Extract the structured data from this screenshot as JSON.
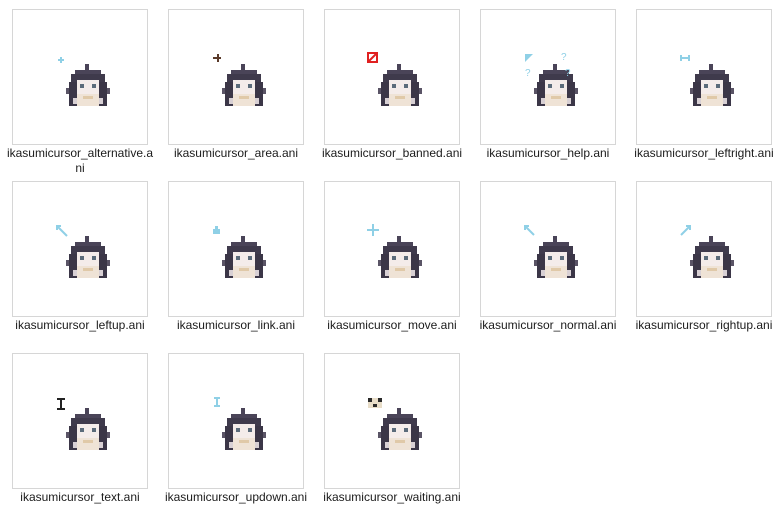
{
  "files": [
    {
      "name": "ikasumicursor_alternative.ani",
      "icon": "alternative-arrow-icon",
      "color": "#8fd0e6"
    },
    {
      "name": "ikasumicursor_area.ani",
      "icon": "crosshair-icon",
      "color": "#5a3a2a"
    },
    {
      "name": "ikasumicursor_banned.ani",
      "icon": "banned-icon",
      "color": "#e02020"
    },
    {
      "name": "ikasumicursor_help.ani",
      "icon": "help-icon",
      "color": "#8fd0e6"
    },
    {
      "name": "ikasumicursor_leftright.ani",
      "icon": "leftright-arrow-icon",
      "color": "#8fd0e6"
    },
    {
      "name": "ikasumicursor_leftup.ani",
      "icon": "leftup-arrow-icon",
      "color": "#8fd0e6"
    },
    {
      "name": "ikasumicursor_link.ani",
      "icon": "link-hand-icon",
      "color": "#8fd0e6"
    },
    {
      "name": "ikasumicursor_move.ani",
      "icon": "move-arrows-icon",
      "color": "#8fd0e6"
    },
    {
      "name": "ikasumicursor_normal.ani",
      "icon": "normal-arrow-icon",
      "color": "#8fd0e6"
    },
    {
      "name": "ikasumicursor_rightup.ani",
      "icon": "rightup-arrow-icon",
      "color": "#8fd0e6"
    },
    {
      "name": "ikasumicursor_text.ani",
      "icon": "text-ibeam-icon",
      "color": "#222222"
    },
    {
      "name": "ikasumicursor_updown.ani",
      "icon": "updown-arrow-icon",
      "color": "#8fd0e6"
    },
    {
      "name": "ikasumicursor_waiting.ani",
      "icon": "waiting-icon",
      "color": "#2a2a2a"
    }
  ]
}
